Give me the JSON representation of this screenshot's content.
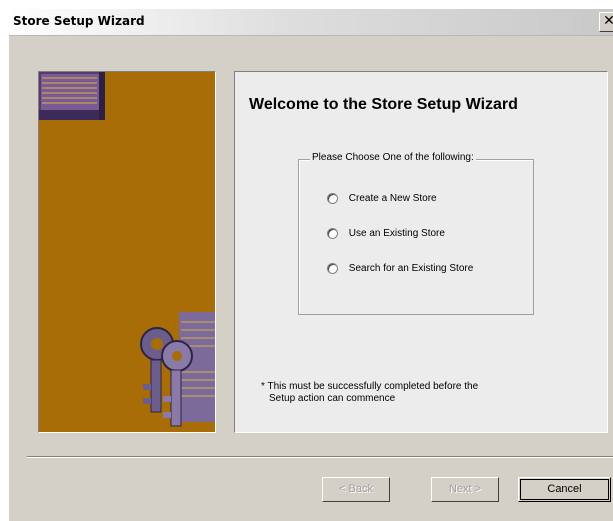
{
  "window": {
    "title": "Store Setup Wizard",
    "close_glyph": "✕"
  },
  "banner": {
    "background_color": "#a86d06",
    "icons": [
      "book-icon",
      "keys-icon"
    ]
  },
  "main": {
    "heading": "Welcome to the Store Setup Wizard",
    "group_label": "Please Choose One of the following:",
    "options": [
      {
        "label": "Create a New Store",
        "selected": false
      },
      {
        "label": "Use an Existing Store",
        "selected": false
      },
      {
        "label": "Search for an Existing Store",
        "selected": false
      }
    ],
    "note_line1": "* This must be successfully completed before the",
    "note_line2": "Setup action can commence"
  },
  "buttons": {
    "back": "< Back",
    "next": "Next >",
    "cancel": "Cancel"
  }
}
